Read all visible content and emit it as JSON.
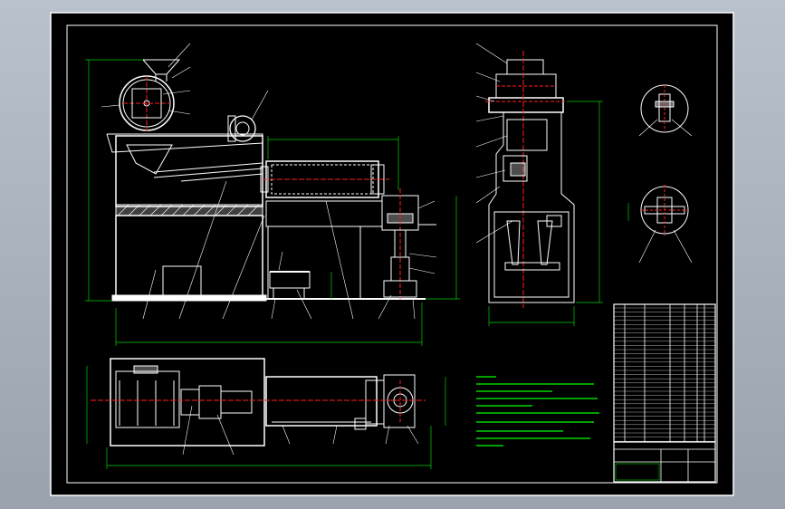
{
  "colors": {
    "background_window": "#a9b2bc",
    "sheet": "#000000",
    "line_primary": "#ffffff",
    "center_line": "#ff2020",
    "dimension": "#00d000",
    "leader": "#ffffff",
    "notes_text": "#00ff00",
    "title_block_text": "#ffffff"
  },
  "views": {
    "front": {
      "name": "front-view"
    },
    "side": {
      "name": "side-view"
    },
    "plan": {
      "name": "plan-view"
    },
    "detail_top": {
      "name": "detail-view-a"
    },
    "detail_bottom": {
      "name": "detail-view-b"
    }
  },
  "icons": {
    "feed_hopper": "hopper-icon",
    "fan": "fan-icon",
    "drum": "drum-icon"
  }
}
